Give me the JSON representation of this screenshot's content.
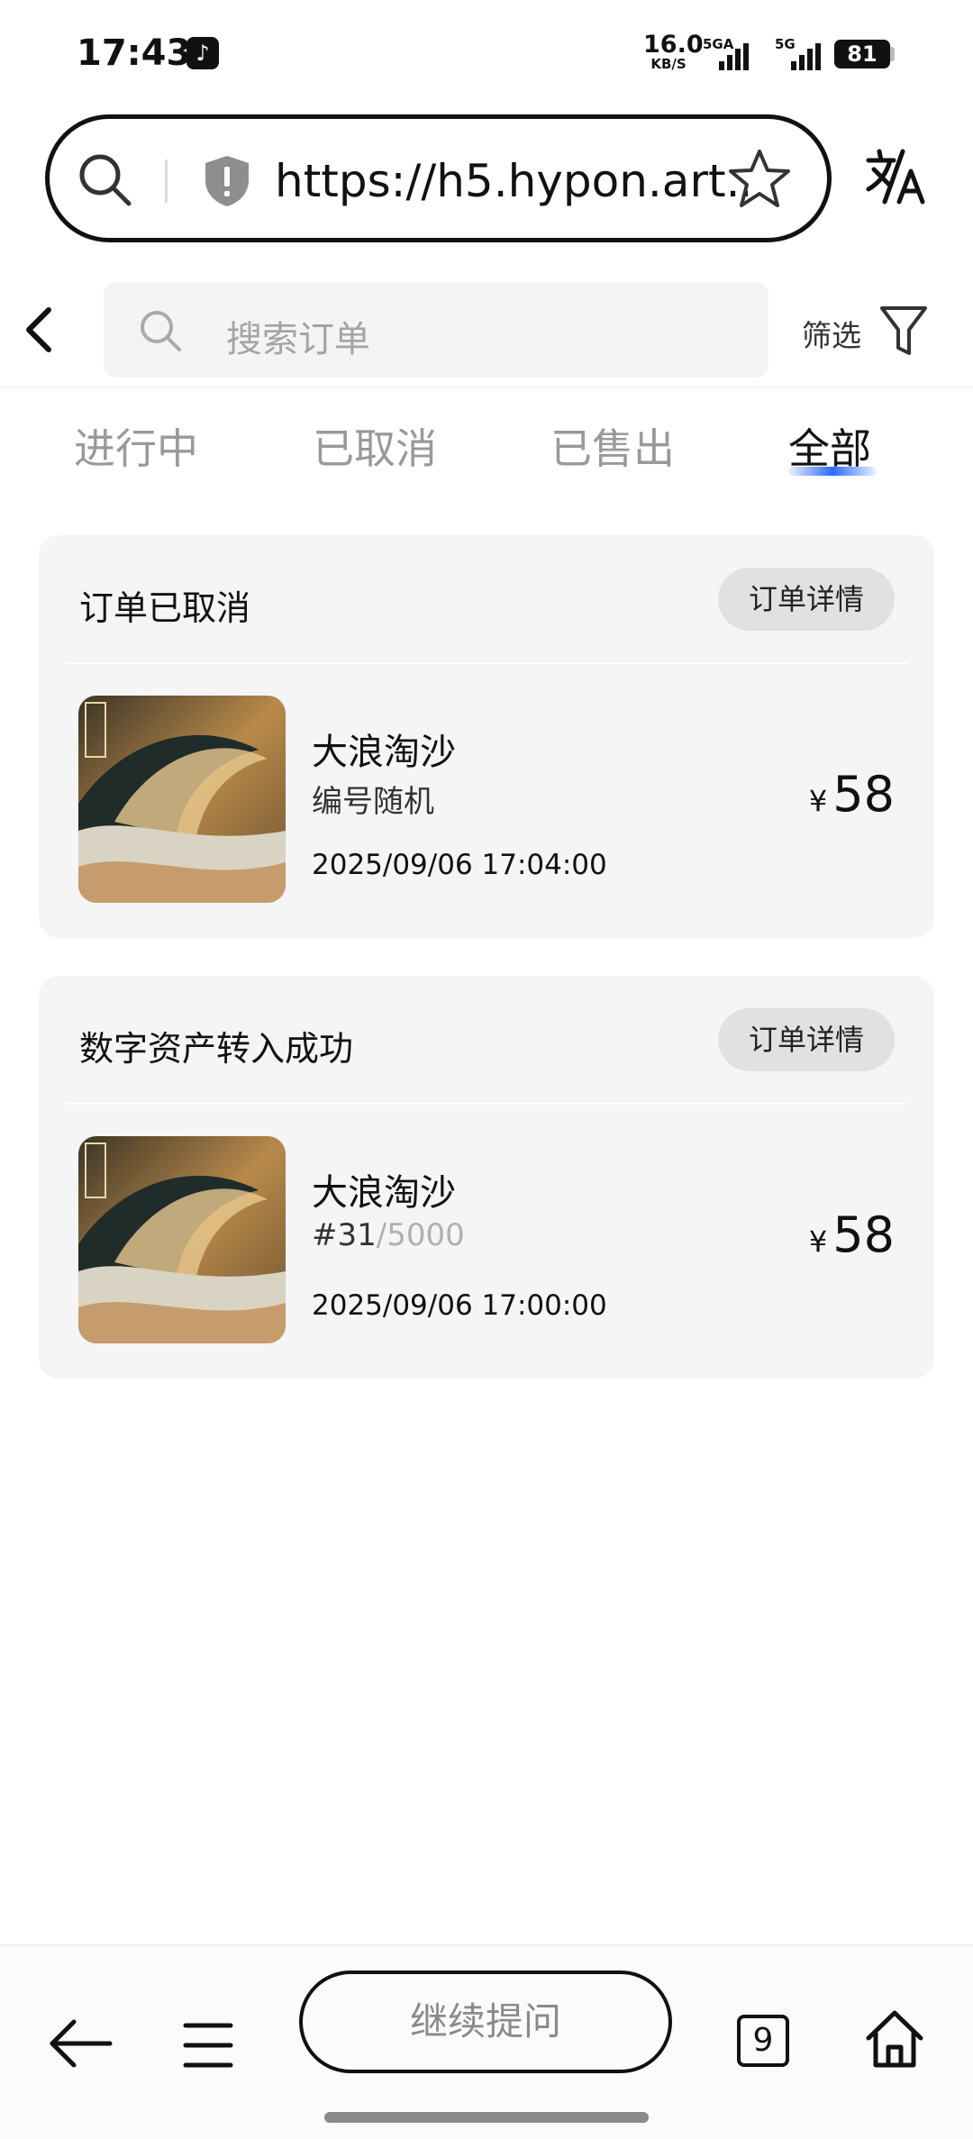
{
  "status_bar": {
    "time": "17:43",
    "app_icon": "tiktok-icon",
    "net_speed_value": "16.0",
    "net_speed_unit": "KB/S",
    "signal_1_label": "5GA",
    "signal_2_label": "5G",
    "battery": "81"
  },
  "browser": {
    "url": "https://h5.hypon.art...",
    "icons": [
      "search-icon",
      "shield-icon",
      "star-icon",
      "translate-icon"
    ]
  },
  "header": {
    "search_placeholder": "搜索订单",
    "filter_label": "筛选"
  },
  "tabs": [
    {
      "label": "进行中",
      "active": false
    },
    {
      "label": "已取消",
      "active": false
    },
    {
      "label": "已售出",
      "active": false
    },
    {
      "label": "全部",
      "active": true
    }
  ],
  "orders": [
    {
      "status": "订单已取消",
      "detail_button": "订单详情",
      "name": "大浪淘沙",
      "serial_text": "编号随机",
      "serial_total": "",
      "time": "2025/09/06 17:04:00",
      "currency": "¥",
      "price": "58"
    },
    {
      "status": "数字资产转入成功",
      "detail_button": "订单详情",
      "name": "大浪淘沙",
      "serial_text": "#31",
      "serial_total": "/5000",
      "time": "2025/09/06 17:00:00",
      "currency": "¥",
      "price": "58"
    }
  ],
  "bottom_bar": {
    "ask_button": "继续提问",
    "tab_count": "9"
  },
  "colors": {
    "tab_underline": "#2e6bff",
    "card_background": "#f5f5f5",
    "detail_button_background": "#e1e1e1"
  }
}
